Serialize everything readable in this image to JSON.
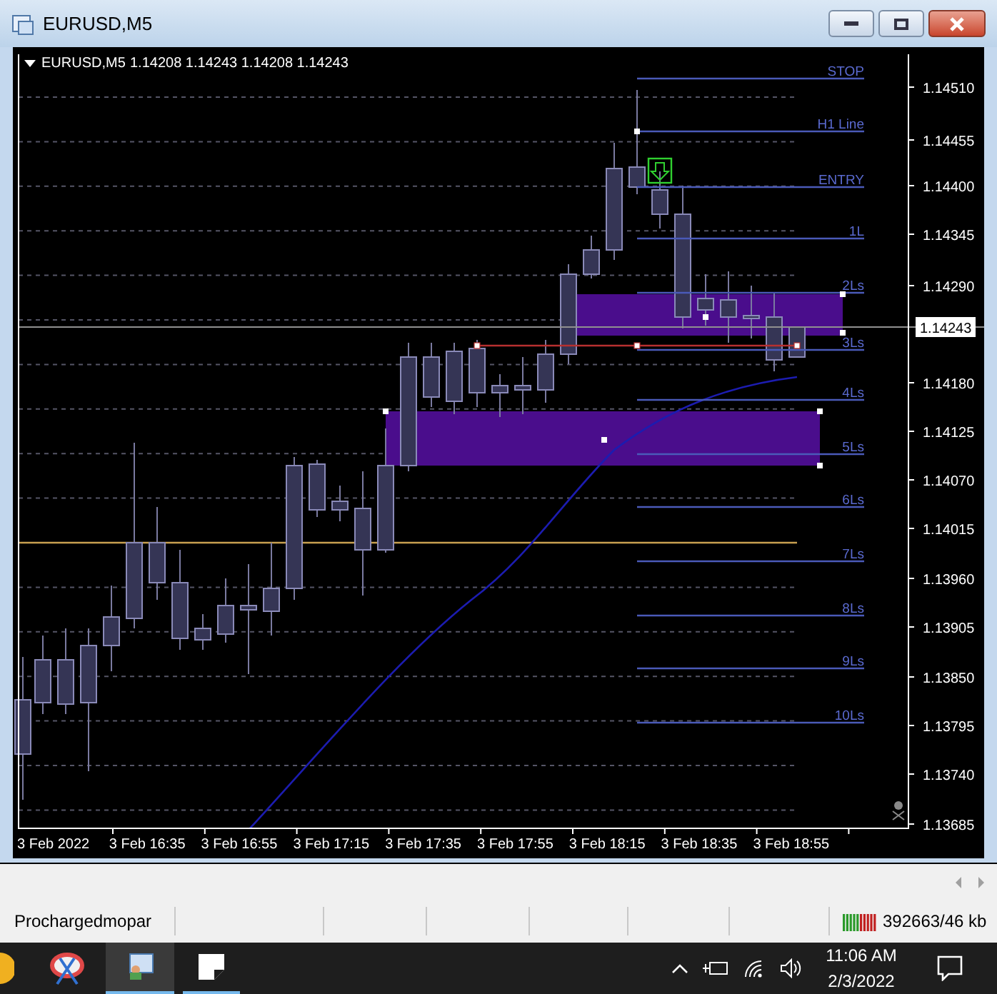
{
  "window": {
    "title": "EURUSD,M5"
  },
  "chart": {
    "symbol": "EURUSD,M5",
    "ohlc": "1.14208 1.14243 1.14208 1.14243",
    "current_price": "1.14243",
    "levels": [
      {
        "label": "STOP"
      },
      {
        "label": "H1 Line"
      },
      {
        "label": "ENTRY"
      },
      {
        "label": "1L"
      },
      {
        "label": "2Ls"
      },
      {
        "label": "3Ls"
      },
      {
        "label": "4Ls"
      },
      {
        "label": "5Ls"
      },
      {
        "label": "6Ls"
      },
      {
        "label": "7Ls"
      },
      {
        "label": "8Ls"
      },
      {
        "label": "9Ls"
      },
      {
        "label": "10Ls"
      }
    ],
    "price_axis": [
      "1.14510",
      "1.14455",
      "1.14400",
      "1.14345",
      "1.14290",
      "1.14180",
      "1.14125",
      "1.14070",
      "1.14015",
      "1.13960",
      "1.13905",
      "1.13850",
      "1.13795",
      "1.13740",
      "1.13685"
    ],
    "time_axis": [
      "3 Feb 2022",
      "3 Feb 16:35",
      "3 Feb 16:55",
      "3 Feb 17:15",
      "3 Feb 17:35",
      "3 Feb 17:55",
      "3 Feb 18:15",
      "3 Feb 18:35",
      "3 Feb 18:55"
    ]
  },
  "status_bar": {
    "account": "Prochargedmopar",
    "traffic": "392663/46 kb"
  },
  "taskbar": {
    "time": "11:06 AM",
    "date": "2/3/2022"
  }
}
